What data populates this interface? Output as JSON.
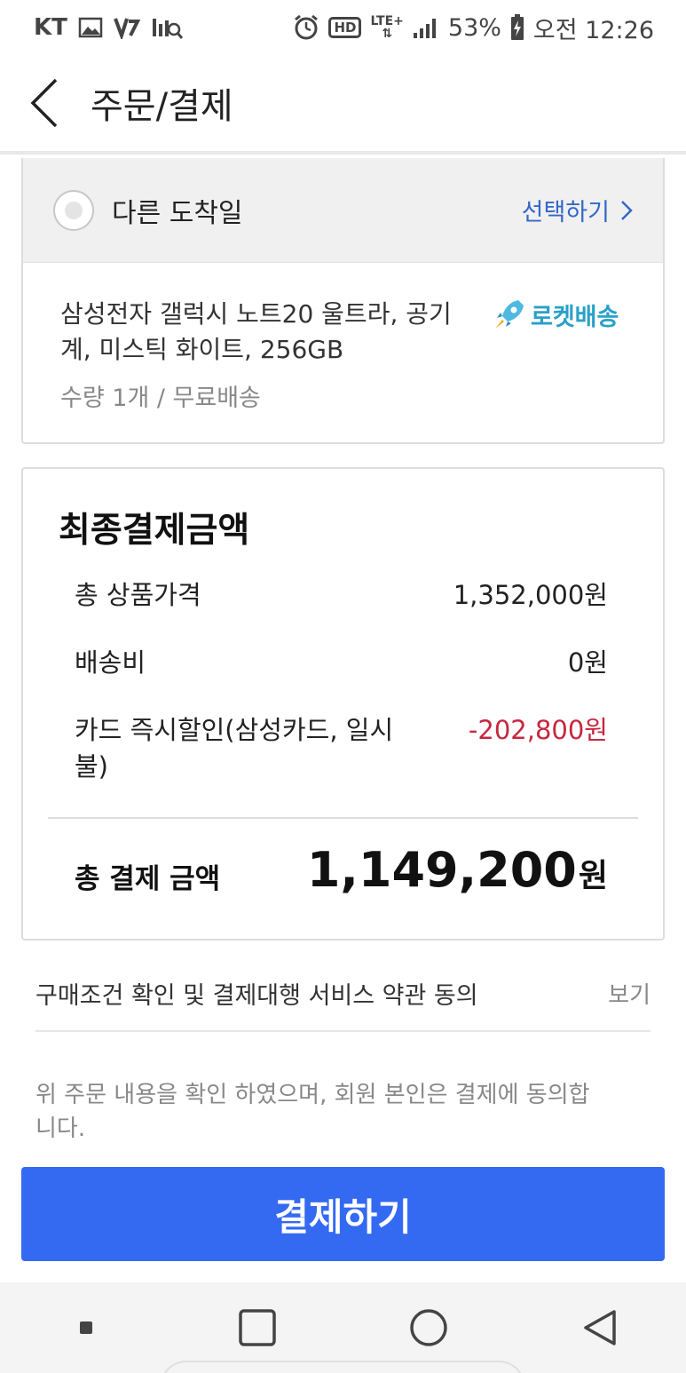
{
  "status_bar": {
    "carrier": "KT",
    "battery": "53%",
    "time": "오전 12:26",
    "network": "LTE+",
    "hd_label": "HD"
  },
  "header": {
    "title": "주문/결제"
  },
  "delivery": {
    "alt_date_label": "다른 도착일",
    "select_label": "선택하기",
    "product_name": "삼성전자 갤럭시 노트20 울트라, 공기계, 미스틱 화이트, 256GB",
    "quantity_shipping": "수량 1개 / 무료배송",
    "badge_label": "로켓배송"
  },
  "summary": {
    "title": "최종결제금액",
    "items": [
      {
        "label": "총 상품가격",
        "value": "1,352,000원"
      },
      {
        "label": "배송비",
        "value": "0원"
      },
      {
        "label": "카드 즉시할인(삼성카드, 일시불)",
        "value": "-202,800원"
      }
    ],
    "total_label": "총 결제 금액",
    "total_value": "1,149,200",
    "total_unit": "원"
  },
  "terms": {
    "text": "구매조건 확인 및 결제대행 서비스 약관 동의",
    "view_label": "보기"
  },
  "consent": "위 주문 내용을 확인 하였으며, 회원 본인은 결제에 동의합니다.",
  "pay_button": "결제하기",
  "colors": {
    "accent": "#3469f2",
    "link": "#3467c8",
    "discount": "#c7273f",
    "rocket": "#29a0c9"
  }
}
